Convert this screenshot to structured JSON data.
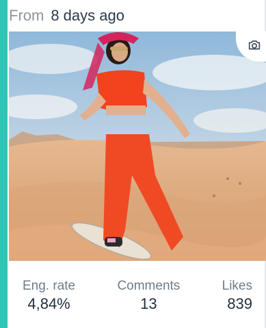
{
  "header": {
    "from_label": "From",
    "time_ago": "8 days ago"
  },
  "media": {
    "type_icon": "camera-icon"
  },
  "stats": [
    {
      "label": "Eng. rate",
      "value": "4,84%"
    },
    {
      "label": "Comments",
      "value": "13"
    },
    {
      "label": "Likes",
      "value": "839"
    }
  ],
  "colors": {
    "accent": "#2ec4b6",
    "text": "#1f2d3d",
    "muted": "#6e7c89"
  }
}
